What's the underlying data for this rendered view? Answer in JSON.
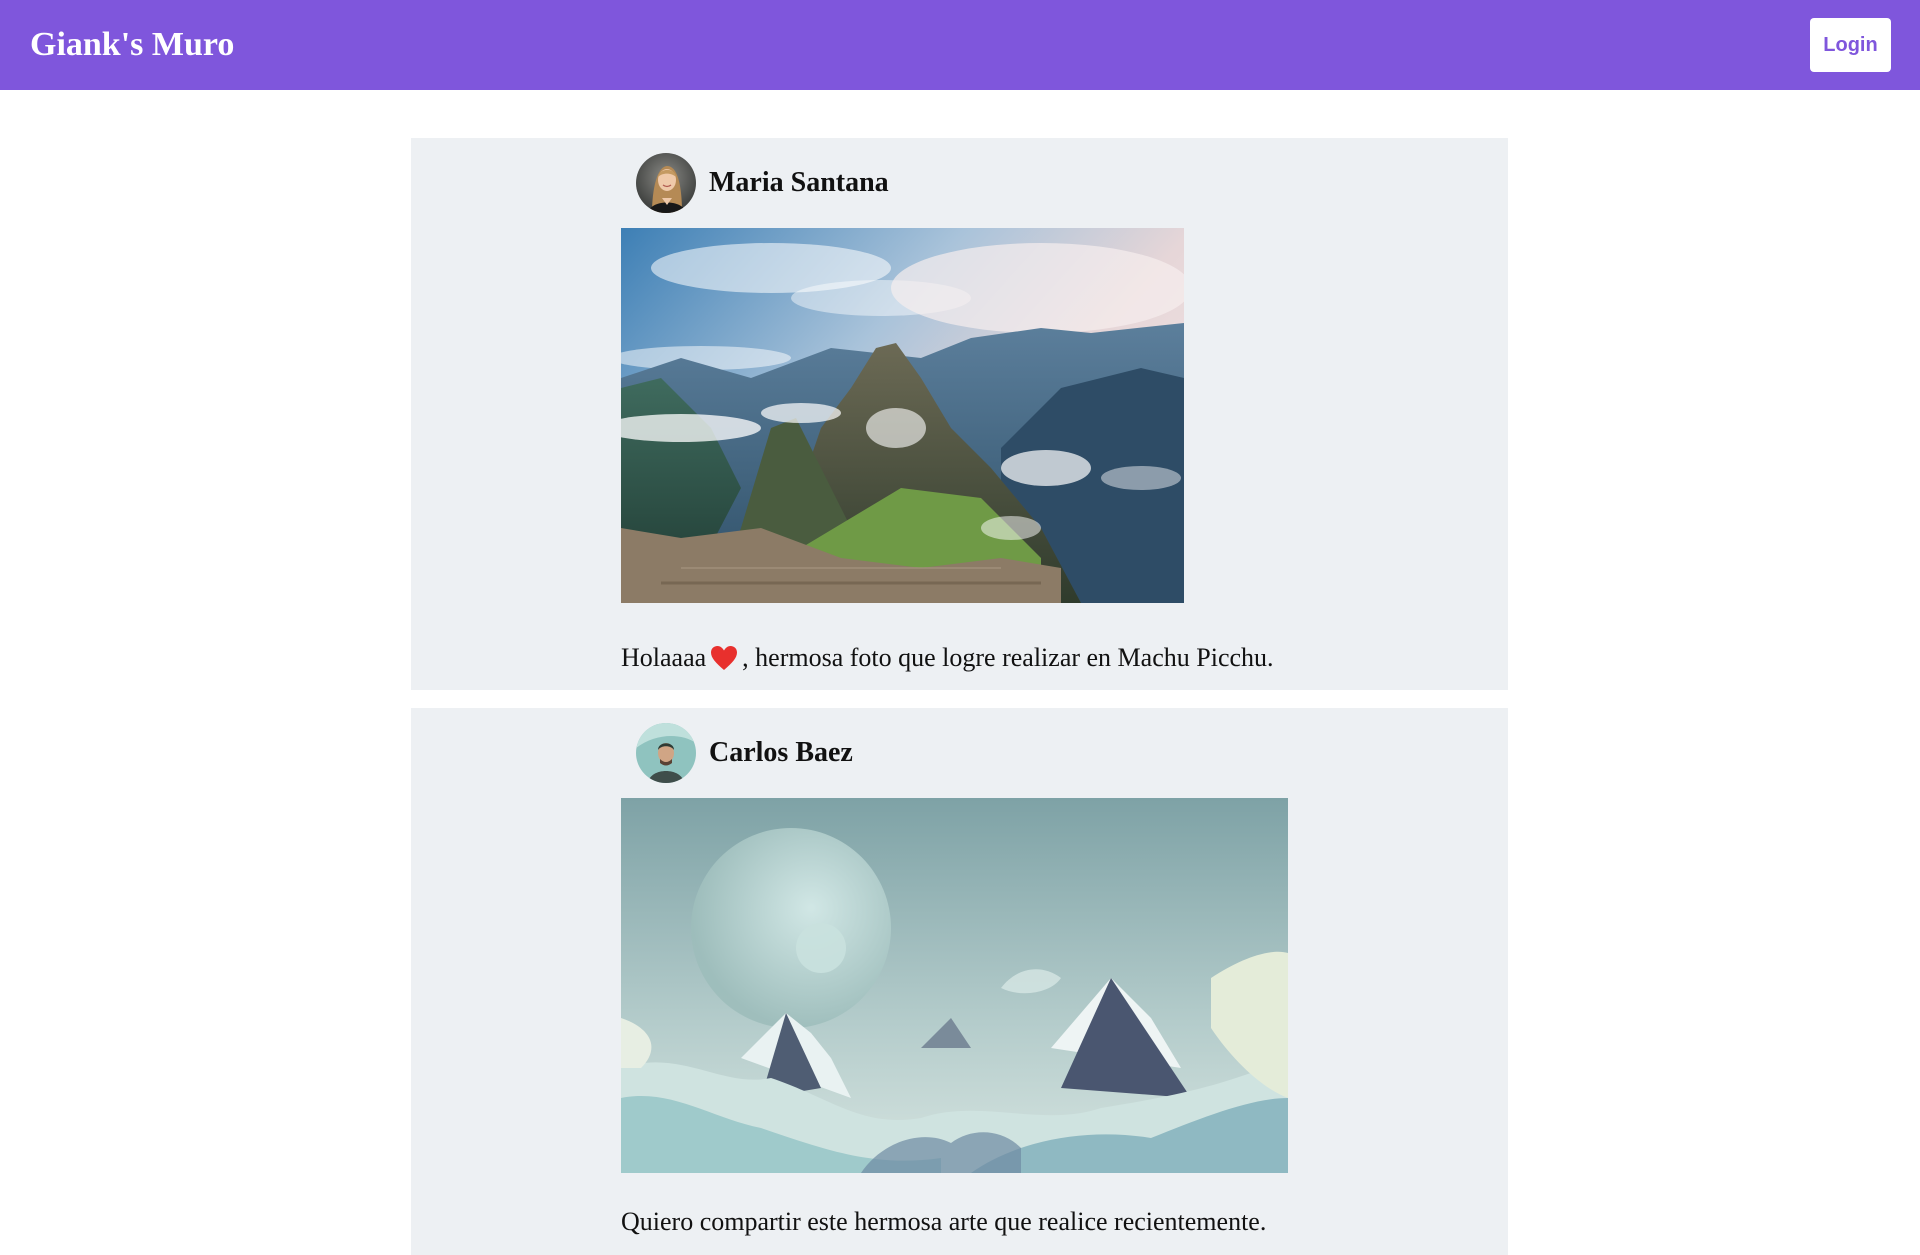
{
  "header": {
    "brand": "Giank's Muro",
    "login_label": "Login",
    "background_color": "#7f56dc"
  },
  "posts": [
    {
      "author": "Maria Santana",
      "avatar_icon": "avatar-woman-photo",
      "image_subject": "machu-picchu-photo",
      "caption_before": "Holaaaa",
      "caption_emoji": "heart-icon",
      "caption_after": ", hermosa foto que logre realizar en Machu Picchu."
    },
    {
      "author": "Carlos Baez",
      "avatar_icon": "avatar-man-photo",
      "image_subject": "planet-over-clouds-artwork",
      "caption": "Quiero compartir este hermosa arte que realice recientemente."
    }
  ],
  "colors": {
    "post_background": "#edf0f3",
    "heart": "#e8302d"
  }
}
